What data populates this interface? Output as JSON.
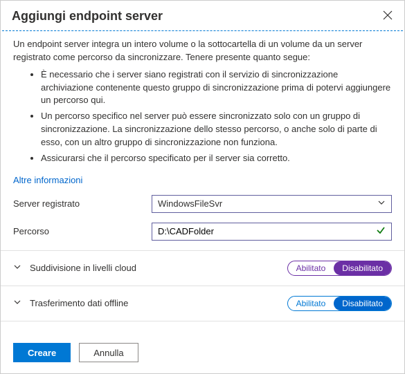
{
  "header": {
    "title": "Aggiungi endpoint server"
  },
  "intro": "Un endpoint server integra un intero volume o la sottocartella di un volume da un server registrato come percorso da sincronizzare. Tenere presente quanto segue:",
  "bullets": [
    "È necessario che i server siano registrati con il servizio di sincronizzazione archiviazione contenente questo gruppo di sincronizzazione prima di potervi aggiungere un percorso qui.",
    "Un percorso specifico nel server può essere sincronizzato solo con un gruppo di sincronizzazione. La sincronizzazione dello stesso percorso, o anche solo di parte di esso, con un altro gruppo di sincronizzazione non funziona.",
    "Assicurarsi che il percorso specificato per il server sia corretto."
  ],
  "more_info": "Altre informazioni",
  "form": {
    "server_label": "Server registrato",
    "server_value": "WindowsFileSvr",
    "path_label": "Percorso",
    "path_value": "D:\\CADFolder"
  },
  "sections": {
    "cloud_tiering": {
      "label": "Suddivisione in livelli cloud",
      "enabled_label": "Abilitato",
      "disabled_label": "Disabilitato"
    },
    "offline_transfer": {
      "label": "Trasferimento dati offline",
      "enabled_label": "Abilitato",
      "disabled_label": "Disabilitato"
    }
  },
  "footer": {
    "create": "Creare",
    "cancel": "Annulla"
  }
}
